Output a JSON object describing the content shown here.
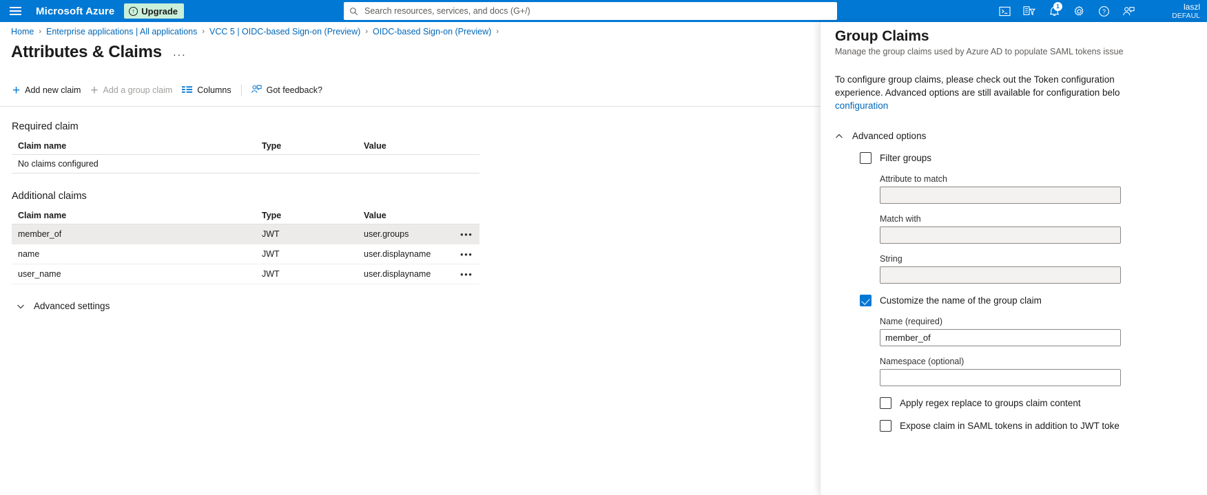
{
  "topbar": {
    "menu_icon": "hamburger-menu-icon",
    "brand": "Microsoft Azure",
    "upgrade_label": "Upgrade",
    "search_placeholder": "Search resources, services, and docs (G+/)",
    "notification_count": "1",
    "account_name": "laszl",
    "account_org": "DEFAUL"
  },
  "breadcrumb": {
    "items": [
      "Home",
      "Enterprise applications | All applications",
      "VCC 5 | OIDC-based Sign-on (Preview)",
      "OIDC-based Sign-on (Preview)"
    ],
    "separator": "›"
  },
  "page": {
    "title": "Attributes & Claims",
    "more_label": "···"
  },
  "commandbar": {
    "add_new_claim": "Add new claim",
    "add_group_claim": "Add a group claim",
    "columns": "Columns",
    "got_feedback": "Got feedback?"
  },
  "required_claims": {
    "heading": "Required claim",
    "columns": [
      "Claim name",
      "Type",
      "Value"
    ],
    "empty_text": "No claims configured"
  },
  "additional_claims": {
    "heading": "Additional claims",
    "columns": [
      "Claim name",
      "Type",
      "Value"
    ],
    "rows": [
      {
        "name": "member_of",
        "type": "JWT",
        "value": "user.groups",
        "selected": true
      },
      {
        "name": "name",
        "type": "JWT",
        "value": "user.displayname",
        "selected": false
      },
      {
        "name": "user_name",
        "type": "JWT",
        "value": "user.displayname",
        "selected": false
      }
    ],
    "row_menu": "•••"
  },
  "advanced_settings": {
    "label": "Advanced settings"
  },
  "panel": {
    "title": "Group Claims",
    "subtitle": "Manage the group claims used by Azure AD to populate SAML tokens issue",
    "description_line1": "To configure group claims, please check out the Token configuration",
    "description_line2": "experience. Advanced options are still available for configuration belo",
    "description_link": "configuration",
    "advanced_options_label": "Advanced options",
    "filter_groups": {
      "label": "Filter groups",
      "checked": false
    },
    "attribute_to_match": {
      "label": "Attribute to match",
      "value": "",
      "disabled": true
    },
    "match_with": {
      "label": "Match with",
      "value": "",
      "disabled": true
    },
    "string_field": {
      "label": "String",
      "value": "",
      "disabled": true
    },
    "customize_name": {
      "label": "Customize the name of the group claim",
      "checked": true
    },
    "name_required": {
      "label": "Name (required)",
      "value": "member_of",
      "disabled": false
    },
    "namespace_optional": {
      "label": "Namespace (optional)",
      "value": "",
      "disabled": false
    },
    "apply_regex": {
      "label": "Apply regex replace to groups claim content",
      "checked": false
    },
    "expose_saml": {
      "label": "Expose claim in SAML tokens in addition to JWT toke",
      "checked": false
    }
  },
  "colors": {
    "azure_blue": "#0078d4",
    "link_blue": "#0067b8",
    "upgrade_green": "#c9f0d9",
    "row_selected": "#edebe9"
  }
}
